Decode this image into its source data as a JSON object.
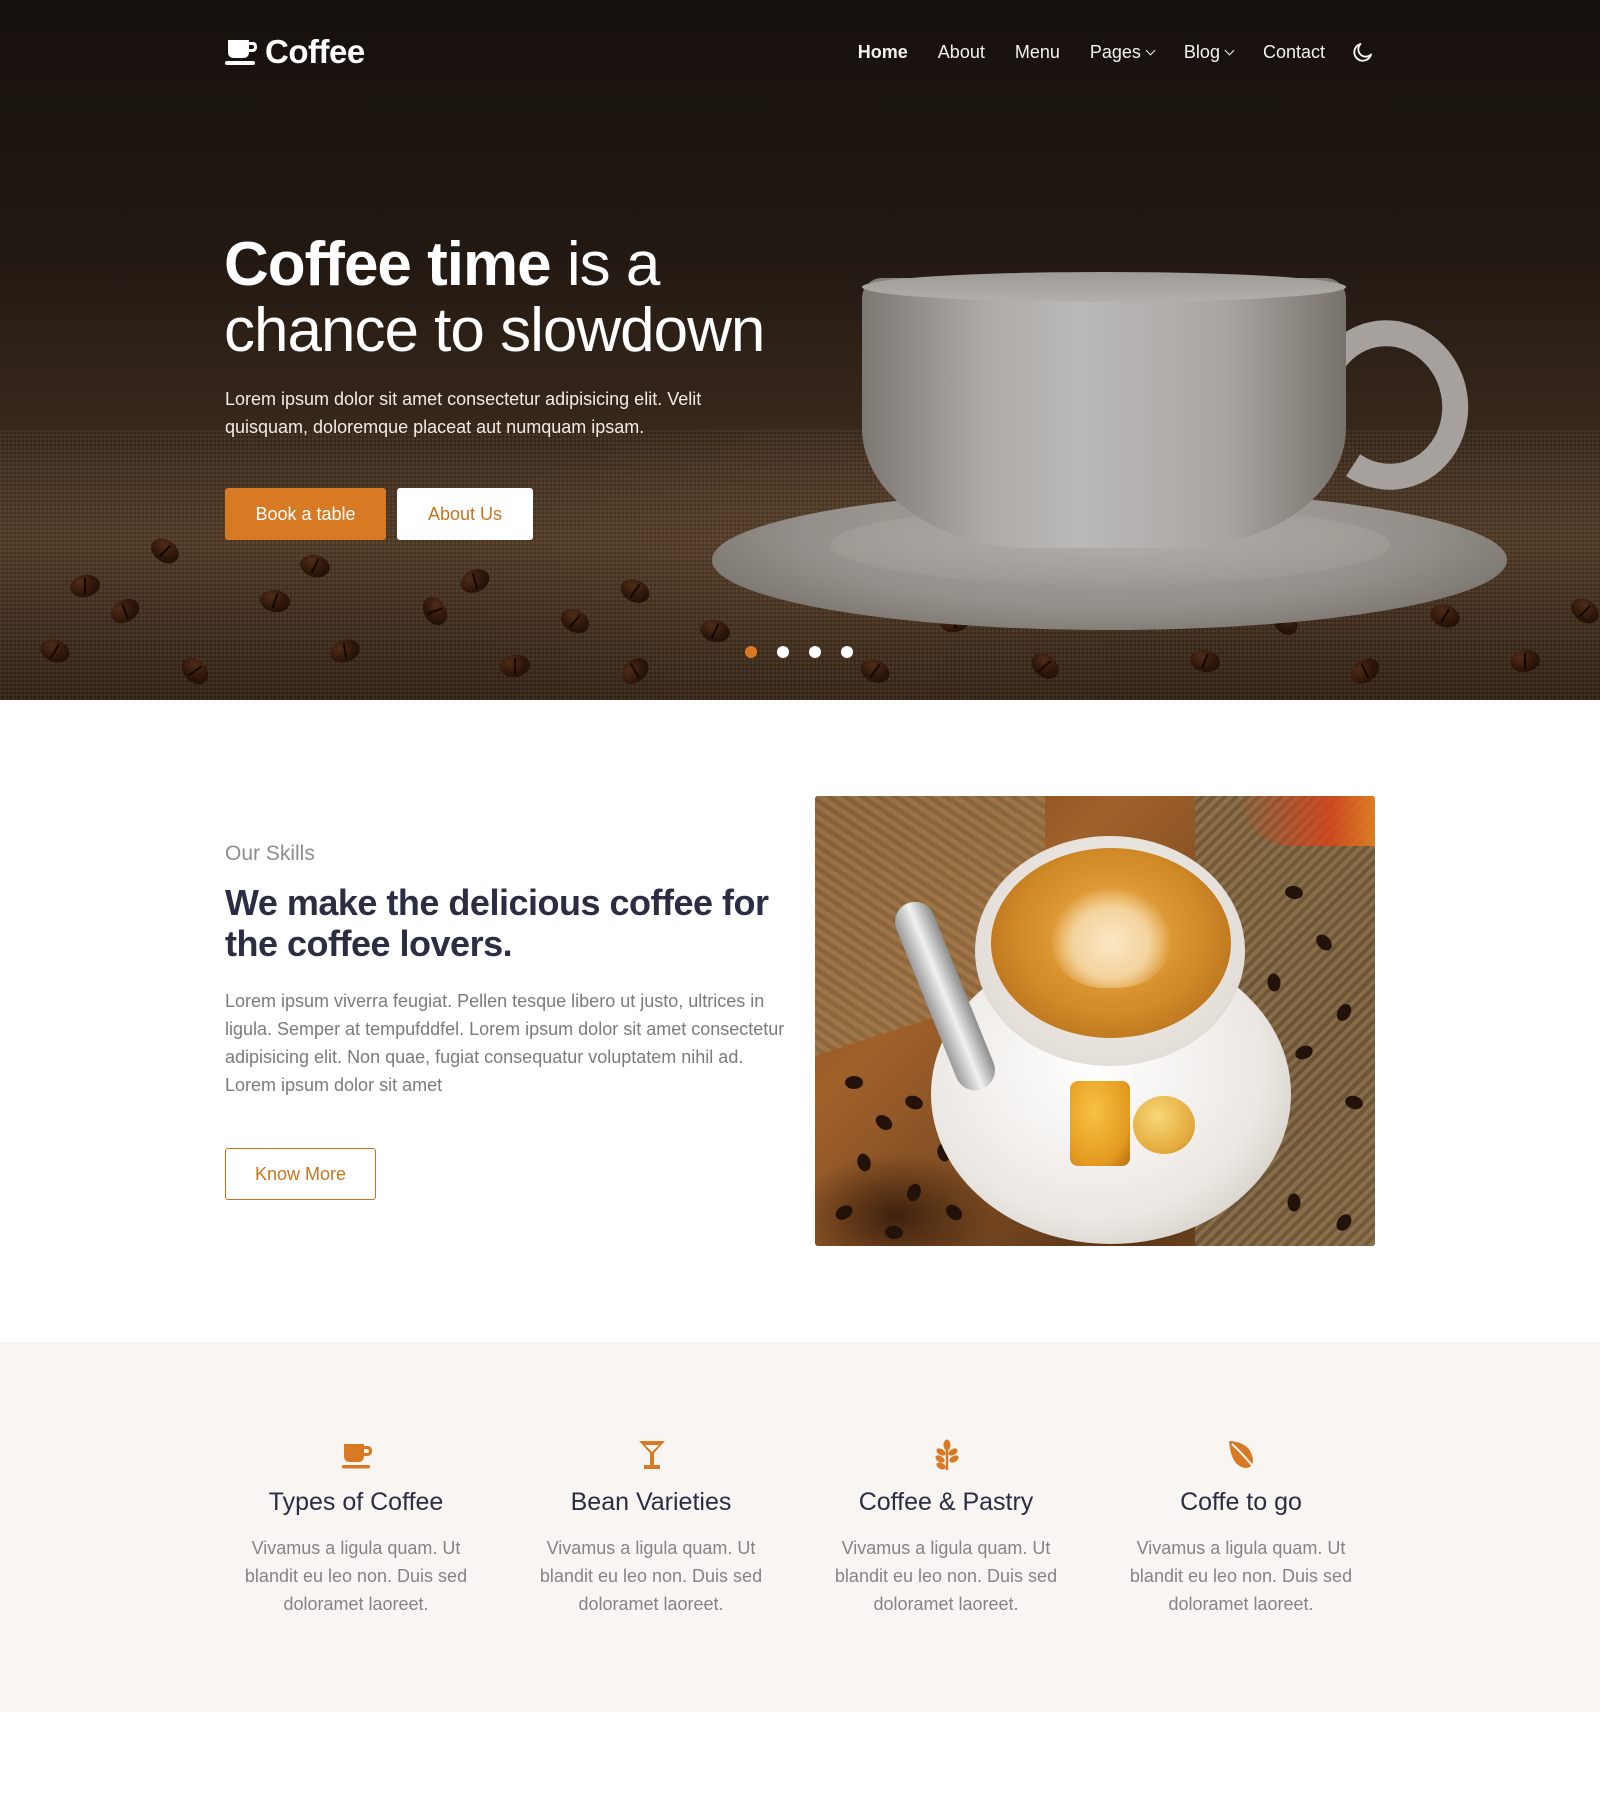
{
  "brand": {
    "name": "Coffee",
    "accent": "#d77a23"
  },
  "nav": {
    "items": [
      {
        "label": "Home",
        "active": true,
        "dropdown": false
      },
      {
        "label": "About",
        "active": false,
        "dropdown": false
      },
      {
        "label": "Menu",
        "active": false,
        "dropdown": false
      },
      {
        "label": "Pages",
        "active": false,
        "dropdown": true
      },
      {
        "label": "Blog",
        "active": false,
        "dropdown": true
      },
      {
        "label": "Contact",
        "active": false,
        "dropdown": false
      }
    ],
    "theme_toggle_icon": "moon-icon"
  },
  "hero": {
    "title_strong": "Coffee time",
    "title_rest_1": " is a",
    "title_line_2": "chance to slowdown",
    "description": "Lorem ipsum dolor sit amet consectetur adipisicing elit. Velit quisquam, doloremque placeat aut numquam ipsam.",
    "primary_button": "Book a table",
    "secondary_button": "About Us",
    "slides": 4,
    "active_slide": 1
  },
  "skills": {
    "kicker": "Our Skills",
    "heading": "We make the delicious coffee for the coffee lovers.",
    "text": "Lorem ipsum viverra feugiat. Pellen tesque libero ut justo, ultrices in ligula. Semper at tempufddfel. Lorem ipsum dolor sit amet consectetur adipisicing elit. Non quae, fugiat consequatur voluptatem nihil ad. Lorem ipsum dolor sit amet",
    "button": "Know More"
  },
  "features": [
    {
      "icon": "coffee-cup-icon",
      "title": "Types of Coffee",
      "text": "Vivamus a ligula quam. Ut blandit eu leo non. Duis sed doloramet laoreet."
    },
    {
      "icon": "cocktail-glass-icon",
      "title": "Bean Varieties",
      "text": "Vivamus a ligula quam. Ut blandit eu leo non. Duis sed doloramet laoreet."
    },
    {
      "icon": "seedling-icon",
      "title": "Coffee & Pastry",
      "text": "Vivamus a ligula quam. Ut blandit eu leo non. Duis sed doloramet laoreet."
    },
    {
      "icon": "leaf-icon",
      "title": "Coffe to go",
      "text": "Vivamus a ligula quam. Ut blandit eu leo non. Duis sed doloramet laoreet."
    }
  ]
}
